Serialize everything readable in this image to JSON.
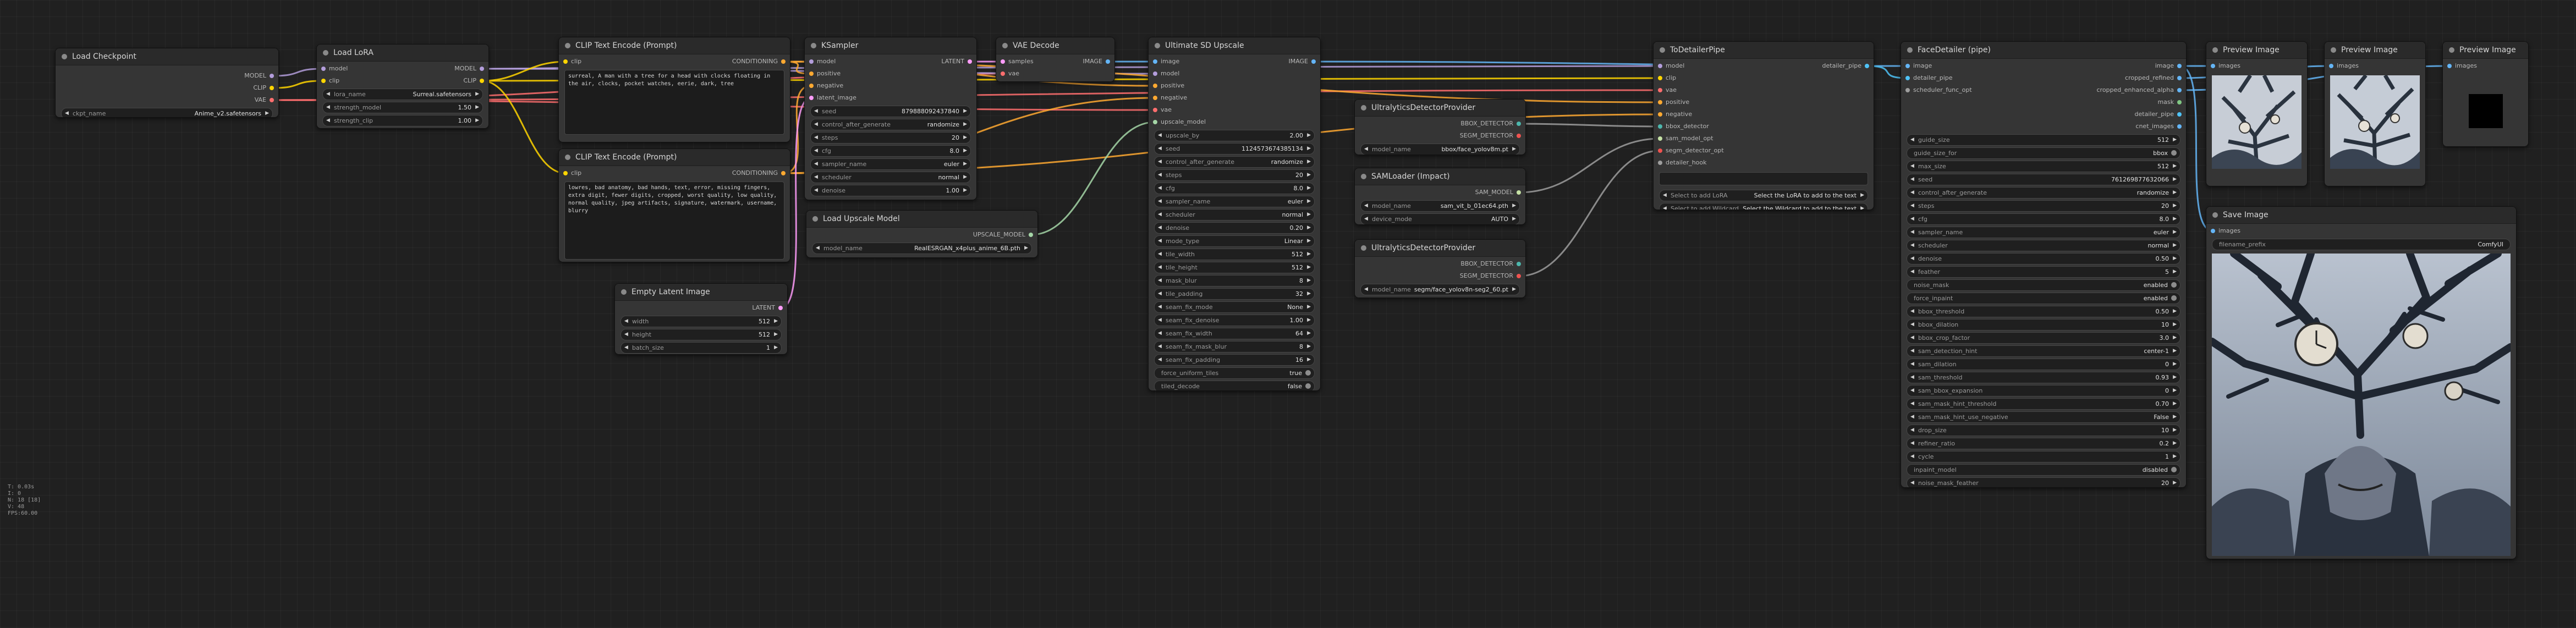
{
  "colors": {
    "model": "#b39ddb",
    "clip": "#ffd500",
    "vae": "#ff6e6e",
    "conditioning": "#ffa931",
    "latent": "#ff9cf9",
    "image": "#64b5f6",
    "upscale_model": "#a5d6a7",
    "detector": "#9e9e9e",
    "sam": "#c5e1a5",
    "pipe": "#4fc3f7"
  },
  "nodes": {
    "checkpoint": {
      "title": "Load Checkpoint",
      "outputs": [
        "MODEL",
        "CLIP",
        "VAE"
      ],
      "widgets": [
        {
          "label": "ckpt_name",
          "value": "Anime_v2.safetensors"
        }
      ]
    },
    "lora": {
      "title": "Load LoRA",
      "inputs": [
        "model",
        "clip"
      ],
      "outputs": [
        "MODEL",
        "CLIP"
      ],
      "widgets": [
        {
          "label": "lora_name",
          "value": "Surreal.safetensors"
        },
        {
          "label": "strength_model",
          "value": "1.50"
        },
        {
          "label": "strength_clip",
          "value": "1.00"
        }
      ]
    },
    "clip_pos": {
      "title": "CLIP Text Encode (Prompt)",
      "inputs": [
        "clip"
      ],
      "outputs": [
        "CONDITIONING"
      ],
      "text": "surreal, A man with a tree for a head with clocks floating in the air, clocks, pocket watches, eerie, dark, tree"
    },
    "clip_neg": {
      "title": "CLIP Text Encode (Prompt)",
      "inputs": [
        "clip"
      ],
      "outputs": [
        "CONDITIONING"
      ],
      "text": "lowres, bad anatomy, bad hands, text, error, missing fingers, extra digit, fewer digits, cropped, worst quality, low quality, normal quality, jpeg artifacts, signature, watermark, username, blurry"
    },
    "empty_latent": {
      "title": "Empty Latent Image",
      "outputs": [
        "LATENT"
      ],
      "widgets": [
        {
          "label": "width",
          "value": "512"
        },
        {
          "label": "height",
          "value": "512"
        },
        {
          "label": "batch_size",
          "value": "1"
        }
      ]
    },
    "ksampler": {
      "title": "KSampler",
      "inputs": [
        "model",
        "positive",
        "negative",
        "latent_image"
      ],
      "outputs": [
        "LATENT"
      ],
      "widgets": [
        {
          "label": "seed",
          "value": "879888092437840"
        },
        {
          "label": "control_after_generate",
          "value": "randomize"
        },
        {
          "label": "steps",
          "value": "20"
        },
        {
          "label": "cfg",
          "value": "8.0"
        },
        {
          "label": "sampler_name",
          "value": "euler"
        },
        {
          "label": "scheduler",
          "value": "normal"
        },
        {
          "label": "denoise",
          "value": "1.00"
        }
      ]
    },
    "vae_decode": {
      "title": "VAE Decode",
      "inputs": [
        "samples",
        "vae"
      ],
      "outputs": [
        "IMAGE"
      ]
    },
    "upscale_loader": {
      "title": "Load Upscale Model",
      "outputs": [
        "UPSCALE_MODEL"
      ],
      "widgets": [
        {
          "label": "model_name",
          "value": "RealESRGAN_x4plus_anime_6B.pth"
        }
      ]
    },
    "ultimate": {
      "title": "Ultimate SD Upscale",
      "inputs": [
        "image",
        "model",
        "positive",
        "negative",
        "vae",
        "upscale_model"
      ],
      "outputs": [
        "IMAGE"
      ],
      "widgets": [
        {
          "label": "upscale_by",
          "value": "2.00"
        },
        {
          "label": "seed",
          "value": "1124573674385134"
        },
        {
          "label": "control_after_generate",
          "value": "randomize"
        },
        {
          "label": "steps",
          "value": "20"
        },
        {
          "label": "cfg",
          "value": "8.0"
        },
        {
          "label": "sampler_name",
          "value": "euler"
        },
        {
          "label": "scheduler",
          "value": "normal"
        },
        {
          "label": "denoise",
          "value": "0.20"
        },
        {
          "label": "mode_type",
          "value": "Linear"
        },
        {
          "label": "tile_width",
          "value": "512"
        },
        {
          "label": "tile_height",
          "value": "512"
        },
        {
          "label": "mask_blur",
          "value": "8"
        },
        {
          "label": "tile_padding",
          "value": "32"
        },
        {
          "label": "seam_fix_mode",
          "value": "None"
        },
        {
          "label": "seam_fix_denoise",
          "value": "1.00"
        },
        {
          "label": "seam_fix_width",
          "value": "64"
        },
        {
          "label": "seam_fix_mask_blur",
          "value": "8"
        },
        {
          "label": "seam_fix_padding",
          "value": "16"
        },
        {
          "label": "force_uniform_tiles",
          "value": "true",
          "toggle": true
        },
        {
          "label": "tiled_decode",
          "value": "false",
          "toggle": true
        }
      ]
    },
    "bbox_provider": {
      "title": "UltralyticsDetectorProvider",
      "outputs": [
        "BBOX_DETECTOR",
        "SEGM_DETECTOR"
      ],
      "widgets": [
        {
          "label": "model_name",
          "value": "bbox/face_yolov8m.pt"
        }
      ]
    },
    "sam_loader": {
      "title": "SAMLoader (Impact)",
      "outputs": [
        "SAM_MODEL"
      ],
      "widgets": [
        {
          "label": "model_name",
          "value": "sam_vit_b_01ec64.pth"
        },
        {
          "label": "device_mode",
          "value": "AUTO"
        }
      ]
    },
    "segm_provider": {
      "title": "UltralyticsDetectorProvider",
      "outputs": [
        "BBOX_DETECTOR",
        "SEGM_DETECTOR"
      ],
      "widgets": [
        {
          "label": "model_name",
          "value": "segm/face_yolov8n-seg2_60.pt"
        }
      ]
    },
    "todetailer": {
      "title": "ToDetailerPipe",
      "inputs": [
        "model",
        "clip",
        "vae",
        "positive",
        "negative",
        "bbox_detector",
        "sam_model_opt",
        "segm_detector_opt",
        "detailer_hook"
      ],
      "outputs": [
        "detailer_pipe"
      ],
      "buttons": [
        {
          "label": "Select to add LoRA",
          "value": "Select the LoRA to add to the text"
        },
        {
          "label": "Select to add Wildcard",
          "value": "Select the Wildcard to add to the text"
        }
      ]
    },
    "facedetailer": {
      "title": "FaceDetailer (pipe)",
      "inputs": [
        "image",
        "detailer_pipe",
        "scheduler_func_opt"
      ],
      "outputs": [
        "image",
        "cropped_refined",
        "cropped_enhanced_alpha",
        "mask",
        "detailer_pipe",
        "cnet_images"
      ],
      "widgets": [
        {
          "label": "guide_size",
          "value": "512"
        },
        {
          "label": "guide_size_for",
          "value": "bbox",
          "toggle": true
        },
        {
          "label": "max_size",
          "value": "512"
        },
        {
          "label": "seed",
          "value": "761269877632066"
        },
        {
          "label": "control_after_generate",
          "value": "randomize"
        },
        {
          "label": "steps",
          "value": "20"
        },
        {
          "label": "cfg",
          "value": "8.0"
        },
        {
          "label": "sampler_name",
          "value": "euler"
        },
        {
          "label": "scheduler",
          "value": "normal"
        },
        {
          "label": "denoise",
          "value": "0.50"
        },
        {
          "label": "feather",
          "value": "5"
        },
        {
          "label": "noise_mask",
          "value": "enabled",
          "toggle": true
        },
        {
          "label": "force_inpaint",
          "value": "enabled",
          "toggle": true
        },
        {
          "label": "bbox_threshold",
          "value": "0.50"
        },
        {
          "label": "bbox_dilation",
          "value": "10"
        },
        {
          "label": "bbox_crop_factor",
          "value": "3.0"
        },
        {
          "label": "sam_detection_hint",
          "value": "center-1"
        },
        {
          "label": "sam_dilation",
          "value": "0"
        },
        {
          "label": "sam_threshold",
          "value": "0.93"
        },
        {
          "label": "sam_bbox_expansion",
          "value": "0"
        },
        {
          "label": "sam_mask_hint_threshold",
          "value": "0.70"
        },
        {
          "label": "sam_mask_hint_use_negative",
          "value": "False"
        },
        {
          "label": "drop_size",
          "value": "10"
        },
        {
          "label": "refiner_ratio",
          "value": "0.2"
        },
        {
          "label": "cycle",
          "value": "1"
        },
        {
          "label": "inpaint_model",
          "value": "disabled",
          "toggle": true
        },
        {
          "label": "noise_mask_feather",
          "value": "20"
        }
      ]
    },
    "preview1": {
      "title": "Preview Image",
      "inputs": [
        "images"
      ]
    },
    "preview2": {
      "title": "Preview Image",
      "inputs": [
        "images"
      ]
    },
    "preview3": {
      "title": "Preview Image",
      "inputs": [
        "images"
      ]
    },
    "save": {
      "title": "Save Image",
      "inputs": [
        "images"
      ],
      "widgets": [
        {
          "label": "filename_prefix",
          "value": "ComfyUI"
        }
      ]
    }
  },
  "stats": [
    "T: 0.03s",
    "I: 0",
    "N: 18 [18]",
    "V: 48",
    "FPS:60.00"
  ]
}
